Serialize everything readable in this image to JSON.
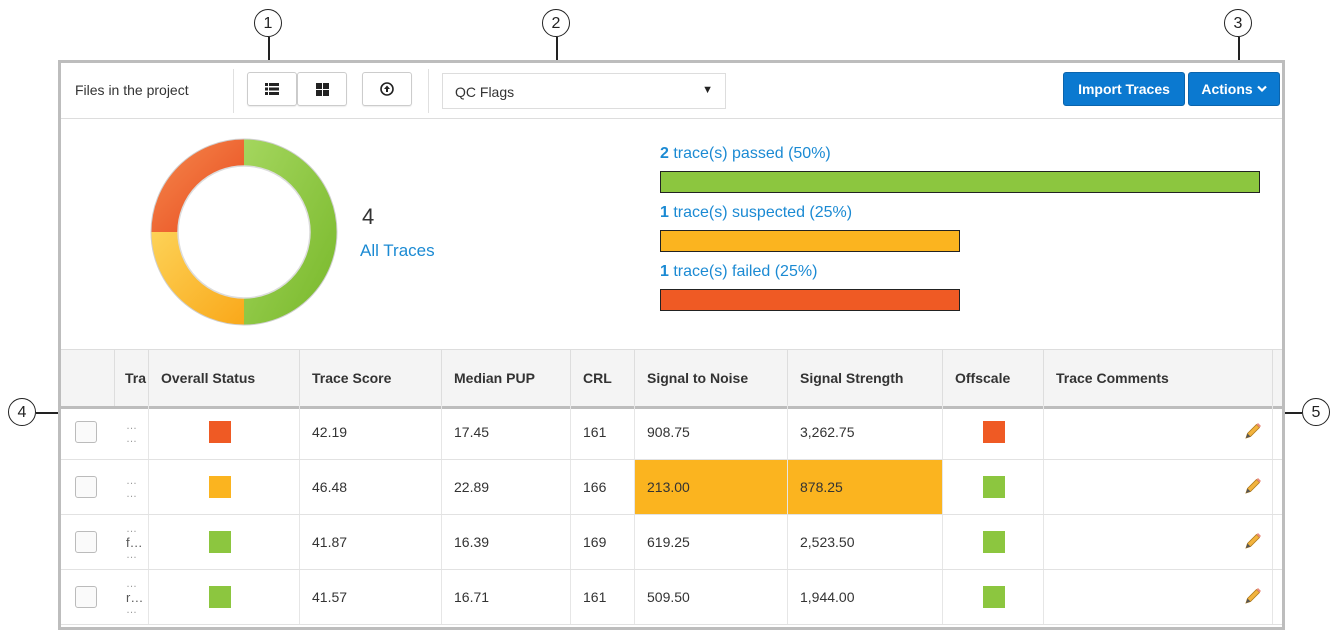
{
  "callouts": [
    "1",
    "2",
    "3",
    "4",
    "5"
  ],
  "colors": {
    "passed": "#8cc63f",
    "suspected": "#fbb41f",
    "failed": "#ef5a24",
    "accent": "#0b79d0",
    "link": "#1b8ad3"
  },
  "toolbar": {
    "files_label": "Files in the project",
    "view_list_icon": "list-icon",
    "view_grid_icon": "grid-icon",
    "upload_icon": "upload-icon",
    "filter_select_value": "QC Flags",
    "import_button": "Import Traces",
    "actions_button": "Actions"
  },
  "summary": {
    "total": "4",
    "all_label": "All Traces",
    "stats": [
      {
        "count": "2",
        "text": " trace(s) passed (50%)",
        "fraction": 0.5,
        "status": "passed"
      },
      {
        "count": "1",
        "text": " trace(s) suspected (25%)",
        "fraction": 0.25,
        "status": "suspected"
      },
      {
        "count": "1",
        "text": " trace(s) failed (25%)",
        "fraction": 0.25,
        "status": "failed"
      }
    ]
  },
  "table": {
    "headers": [
      "",
      "Tra",
      "Overall Status",
      "Trace Score",
      "Median PUP",
      "CRL",
      "Signal to Noise",
      "Signal Strength",
      "Offscale",
      "Trace Comments"
    ],
    "rows": [
      {
        "name_lines": [
          "…",
          "…"
        ],
        "overall": "failed",
        "score": "42.19",
        "pup": "17.45",
        "crl": "161",
        "snr": "908.75",
        "strength": "3,262.75",
        "offscale": "failed",
        "highlight": false
      },
      {
        "name_lines": [
          "…",
          "…"
        ],
        "overall": "suspected",
        "score": "46.48",
        "pup": "22.89",
        "crl": "166",
        "snr": "213.00",
        "strength": "878.25",
        "offscale": "passed",
        "highlight": true
      },
      {
        "name_lines": [
          "…",
          "f…",
          "…"
        ],
        "overall": "passed",
        "score": "41.87",
        "pup": "16.39",
        "crl": "169",
        "snr": "619.25",
        "strength": "2,523.50",
        "offscale": "passed",
        "highlight": false
      },
      {
        "name_lines": [
          "…",
          "r…",
          "…"
        ],
        "overall": "passed",
        "score": "41.57",
        "pup": "16.71",
        "crl": "161",
        "snr": "509.50",
        "strength": "1,944.00",
        "offscale": "passed",
        "highlight": false
      }
    ]
  }
}
